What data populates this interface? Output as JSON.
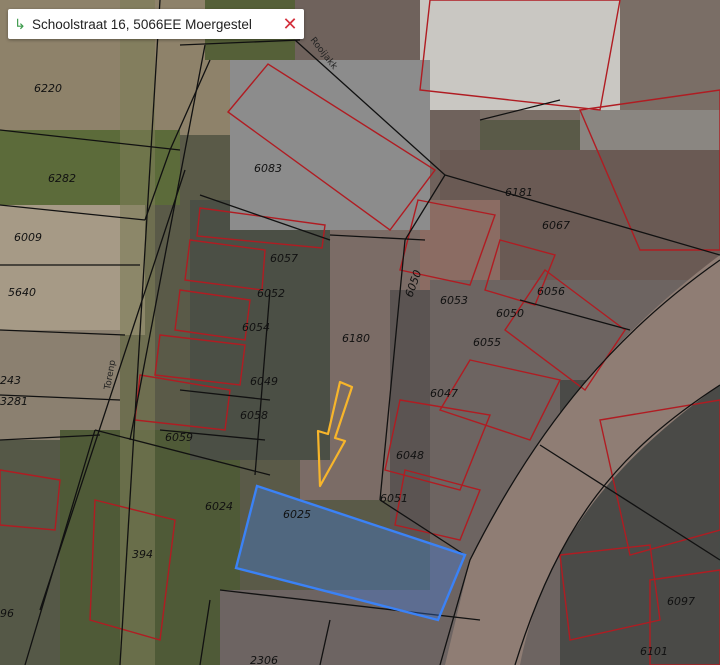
{
  "search": {
    "return_icon": "↳",
    "address": "Schoolstraat 16, 5066EE Moergestel",
    "clear_icon": "✕"
  },
  "map": {
    "parcels": [
      "6220",
      "6282",
      "6009",
      "5640",
      "243",
      "3281",
      "6083",
      "6057",
      "6052",
      "6054",
      "6049",
      "6058",
      "6059",
      "6024",
      "6025",
      "6180",
      "6181",
      "6067",
      "6050",
      "6053",
      "6050",
      "6056",
      "6055",
      "6047",
      "6048",
      "6051",
      "6097",
      "6101",
      "2306",
      "394",
      "96"
    ],
    "streets": [
      "Rooijakk",
      "Torenp"
    ],
    "colors": {
      "parcel_line": "#111111",
      "building_line": "#b01c22",
      "selection": "#3b82f6",
      "arrow": "#f7b52b"
    }
  }
}
